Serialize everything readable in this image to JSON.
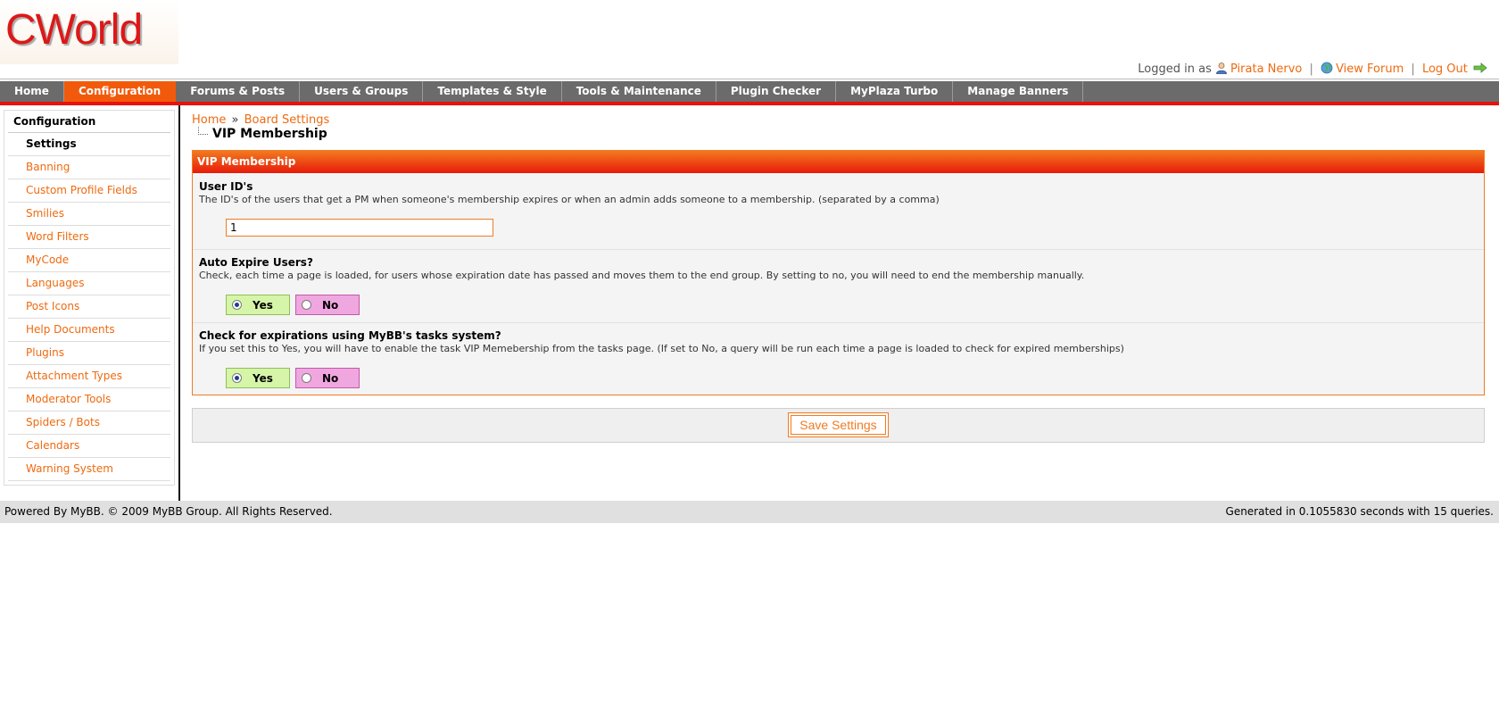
{
  "header": {
    "logo_text": "CWorld",
    "logged_in_prefix": "Logged in as",
    "username": "Pirata Nervo",
    "view_forum": "View Forum",
    "log_out": "Log Out",
    "separator": "|"
  },
  "nav": {
    "items": [
      {
        "label": "Home",
        "active": false
      },
      {
        "label": "Configuration",
        "active": true
      },
      {
        "label": "Forums & Posts",
        "active": false
      },
      {
        "label": "Users & Groups",
        "active": false
      },
      {
        "label": "Templates & Style",
        "active": false
      },
      {
        "label": "Tools & Maintenance",
        "active": false
      },
      {
        "label": "Plugin Checker",
        "active": false
      },
      {
        "label": "MyPlaza Turbo",
        "active": false
      },
      {
        "label": "Manage Banners",
        "active": false
      }
    ]
  },
  "sidebar": {
    "heading": "Configuration",
    "items": [
      {
        "label": "Settings",
        "current": true
      },
      {
        "label": "Banning",
        "current": false
      },
      {
        "label": "Custom Profile Fields",
        "current": false
      },
      {
        "label": "Smilies",
        "current": false
      },
      {
        "label": "Word Filters",
        "current": false
      },
      {
        "label": "MyCode",
        "current": false
      },
      {
        "label": "Languages",
        "current": false
      },
      {
        "label": "Post Icons",
        "current": false
      },
      {
        "label": "Help Documents",
        "current": false
      },
      {
        "label": "Plugins",
        "current": false
      },
      {
        "label": "Attachment Types",
        "current": false
      },
      {
        "label": "Moderator Tools",
        "current": false
      },
      {
        "label": "Spiders / Bots",
        "current": false
      },
      {
        "label": "Calendars",
        "current": false
      },
      {
        "label": "Warning System",
        "current": false
      }
    ]
  },
  "breadcrumb": {
    "home": "Home",
    "separator": "»",
    "board_settings": "Board Settings"
  },
  "page_title": "VIP Membership",
  "panel": {
    "title": "VIP Membership",
    "settings": {
      "user_ids": {
        "title": "User ID's",
        "description": "The ID's of the users that get a PM when someone's membership expires or when an admin adds someone to a membership. (separated by a comma)",
        "value": "1"
      },
      "auto_expire": {
        "title": "Auto Expire Users?",
        "description": "Check, each time a page is loaded, for users whose expiration date has passed and moves them to the end group. By setting to no, you will need to end the membership manually.",
        "yes_label": "Yes",
        "no_label": "No",
        "selected": "Yes"
      },
      "tasks_system": {
        "title": "Check for expirations using MyBB's tasks system?",
        "description": "If you set this to Yes, you will have to enable the task VIP Memebership from the tasks page. (If set to No, a query will be run each time a page is loaded to check for expired memberships)",
        "yes_label": "Yes",
        "no_label": "No",
        "selected": "Yes"
      }
    }
  },
  "save_button": "Save Settings",
  "footer": {
    "left": "Powered By MyBB. © 2009 MyBB Group. All Rights Reserved.",
    "right": "Generated in 0.1055830 seconds with 15 queries."
  },
  "colors": {
    "accent": "#f25a0b",
    "nav_bg": "#6b6b6b",
    "nav_border": "#e8110b",
    "link": "#ee6a10",
    "yes_bg": "#d6f5a8",
    "no_bg": "#f0a7e0"
  },
  "icons": {
    "user": "user-icon",
    "forum": "globe-icon",
    "logout": "arrow-right-icon"
  }
}
